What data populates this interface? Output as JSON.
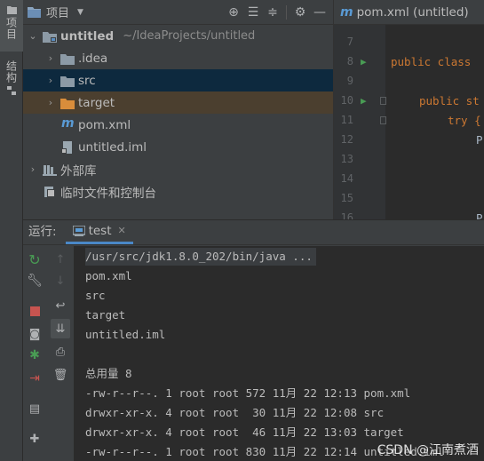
{
  "sidebar": {
    "project_tab": "项目",
    "structure_tab": "结构"
  },
  "project_panel": {
    "title": "项目",
    "tree": [
      {
        "label": "untitled",
        "path": "~/IdeaProjects/untitled",
        "icon": "module-folder-icon",
        "expanded": true
      },
      {
        "label": ".idea",
        "icon": "folder-icon",
        "expanded": false
      },
      {
        "label": "src",
        "icon": "folder-icon",
        "expanded": false
      },
      {
        "label": "target",
        "icon": "excluded-folder-icon",
        "expanded": false
      },
      {
        "label": "pom.xml",
        "icon": "maven-icon"
      },
      {
        "label": "untitled.iml",
        "icon": "iml-file-icon"
      },
      {
        "label": "外部库",
        "icon": "library-icon",
        "expanded": false
      },
      {
        "label": "临时文件和控制台",
        "icon": "scratches-icon"
      }
    ]
  },
  "editor": {
    "tab_title": "pom.xml (untitled)",
    "lines": [
      {
        "num": "7",
        "code": ""
      },
      {
        "num": "8",
        "code": "public class"
      },
      {
        "num": "9",
        "code": ""
      },
      {
        "num": "10",
        "code": "public st"
      },
      {
        "num": "11",
        "code": "try {"
      },
      {
        "num": "12",
        "code": "P"
      },
      {
        "num": "13",
        "code": ""
      },
      {
        "num": "14",
        "code": ""
      },
      {
        "num": "15",
        "code": ""
      },
      {
        "num": "16",
        "code": "P"
      }
    ]
  },
  "run_panel": {
    "label": "运行:",
    "tab": "test",
    "console": [
      "/usr/src/jdk1.8.0_202/bin/java ...",
      "pom.xml",
      "src",
      "target",
      "untitled.iml",
      "",
      "总用量 8",
      "-rw-r--r--. 1 root root 572 11月 22 12:13 pom.xml",
      "drwxr-xr-x. 4 root root  30 11月 22 12:08 src",
      "drwxr-xr-x. 4 root root  46 11月 22 13:03 target",
      "-rw-r--r--. 1 root root 830 11月 22 12:14 untitled.iml"
    ]
  },
  "watermark": "CSDN @江南煮酒",
  "colors": {
    "accent": "#4a88c7",
    "selection_blue": "#0d293e",
    "selection_brown": "#4b3f2f",
    "run_green": "#499c54",
    "stop_red": "#c75450",
    "keyword": "#cc7832"
  }
}
